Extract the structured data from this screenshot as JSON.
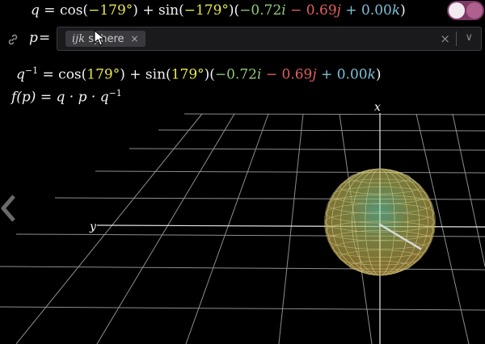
{
  "formulas": {
    "q": {
      "lhs": "q",
      "eq": "=",
      "cos": "cos(",
      "angle1": "−179°",
      "mid": ") + sin(",
      "angle2": "−179°",
      "open": ")(",
      "i_coef": "−0.72",
      "i_sym": "i",
      "j_op": " − ",
      "j_coef": "0.69",
      "j_sym": "j",
      "k_op": " + ",
      "k_coef": "0.00",
      "k_sym": "k",
      "close": ")"
    },
    "qinv": {
      "lhs": "q",
      "sup": "−1",
      "eq": " = ",
      "cos": "cos(",
      "angle1": "179°",
      "mid": ") + sin(",
      "angle2": "179°",
      "open": ")(",
      "i_coef": "−0.72",
      "i_sym": "i",
      "j_op": " − ",
      "j_coef": "0.69",
      "j_sym": "j",
      "k_op": " + ",
      "k_coef": "0.00",
      "k_sym": "k",
      "close": ")"
    },
    "f": {
      "text_f": "f",
      "text_p": "(p)",
      "eq": " = ",
      "rhs": "q · p · q",
      "sup": "−1"
    }
  },
  "input": {
    "label": "p",
    "eq": "=",
    "chip_ijk": "ijk",
    "chip_text": " sphere",
    "chip_close": "×",
    "clear": "×",
    "chevron": "∨"
  },
  "axes": {
    "x_label": "x",
    "y_label": "y"
  },
  "icons": {
    "link": "link-icon",
    "toggle": "plot-toggle-icon",
    "back": "chevron-left-icon"
  },
  "colors": {
    "yellow": "#e8e64a",
    "green": "#8fc97a",
    "red": "#e0605e",
    "blue": "#7fc0d8",
    "toggle": "#7a3a64"
  }
}
